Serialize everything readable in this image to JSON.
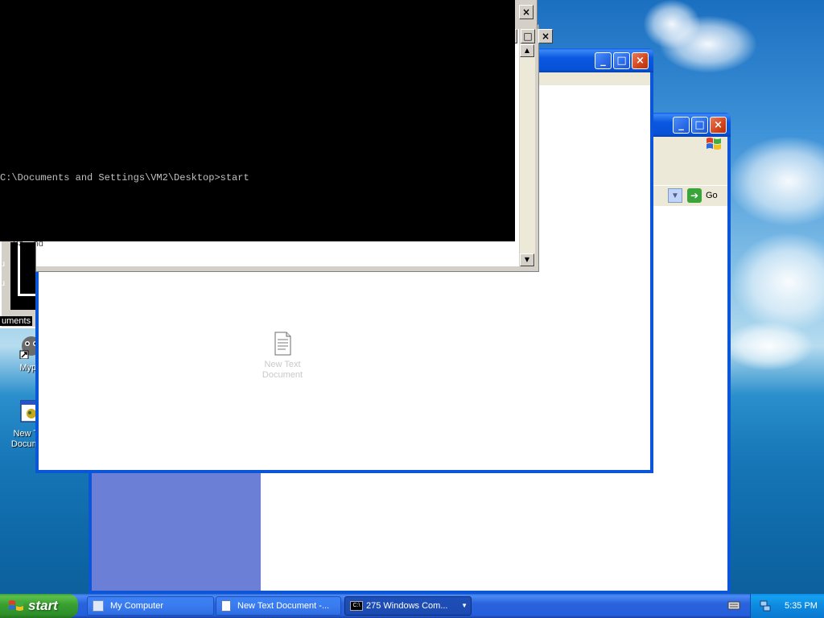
{
  "cmd_window": {
    "output_line": "C:\\Documents and Settings\\VM2\\Desktop>start",
    "close_glyph": "×",
    "maximize_glyph": "□",
    "minimize_glyph": "_"
  },
  "notepad_window": {
    "partial_label": "Ba... nd"
  },
  "explorer_back_window": {
    "go_label": "Go"
  },
  "front_window": {
    "file_icon_label": "New Text Document"
  },
  "desktop": {
    "icons": [
      {
        "label": "Mypal"
      },
      {
        "label": "New Text Document"
      }
    ],
    "partial_text_1": "u",
    "partial_text_2": "u",
    "partial_text_3": "uments"
  },
  "taskbar": {
    "start_label": "start",
    "buttons": [
      {
        "label": "My Computer"
      },
      {
        "label": "New Text Document -..."
      },
      {
        "label": "275 Windows Com..."
      }
    ],
    "clock": "5:35 PM"
  },
  "colors": {
    "accent_blue": "#0b55d8",
    "close_red": "#d2451c",
    "start_green": "#38a030",
    "left_panel": "#6c7fd6"
  }
}
